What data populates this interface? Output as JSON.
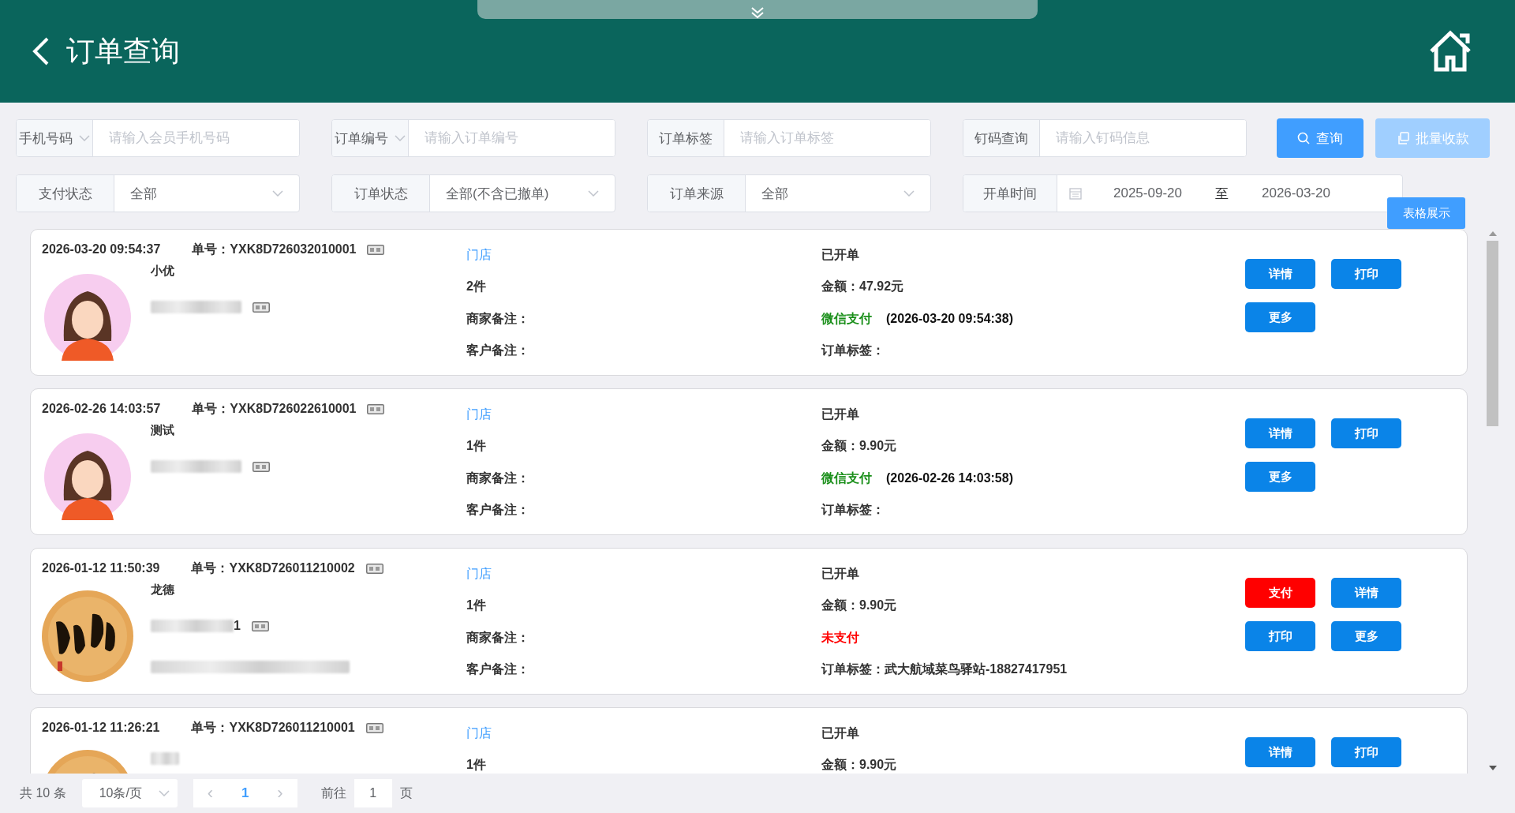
{
  "header": {
    "title": "订单查询"
  },
  "filters": [
    {
      "kind": "input",
      "label": "手机号码",
      "label_dropdown": true,
      "placeholder": "请输入会员手机号码"
    },
    {
      "kind": "input",
      "label": "订单编号",
      "label_dropdown": true,
      "placeholder": "请输入订单编号"
    },
    {
      "kind": "input",
      "label": "订单标签",
      "label_dropdown": false,
      "placeholder": "请输入订单标签"
    },
    {
      "kind": "input",
      "label": "钉码查询",
      "label_dropdown": false,
      "placeholder": "请输入钉码信息"
    },
    {
      "kind": "select",
      "label": "支付状态",
      "value": "全部"
    },
    {
      "kind": "select",
      "label": "订单状态",
      "value": "全部(不含已撤单)"
    },
    {
      "kind": "select",
      "label": "订单来源",
      "value": "全部"
    },
    {
      "kind": "daterange",
      "label": "开单时间",
      "start": "2025-09-20",
      "separator": "至",
      "end": "2026-03-20"
    }
  ],
  "buttons": [
    {
      "label": "查询",
      "kind": "primary"
    },
    {
      "label": "批量收款",
      "kind": "disabled"
    }
  ],
  "table_view_button": "表格展示",
  "orders": [
    {
      "created": "2026-03-20 09:54:37",
      "order_no": "单号：YXK8D726032010001",
      "avatar": {
        "kind": "figure"
      },
      "name": "小优",
      "redacted": [
        {
          "kind": "phone"
        }
      ],
      "source": "门店",
      "quantity": "2件",
      "merchant_note": "商家备注：",
      "customer_note": "客户备注：",
      "status": "已开单",
      "amount": "金额：47.92元",
      "payment": {
        "label": "微信支付",
        "paid": true,
        "time": "(2026-03-20 09:54:38)"
      },
      "tag": "订单标签：",
      "actions": [
        {
          "label": "详情",
          "kind": "primary"
        },
        {
          "label": "打印",
          "kind": "primary"
        },
        {
          "label": "更多",
          "kind": "primary"
        }
      ]
    },
    {
      "created": "2026-02-26 14:03:57",
      "order_no": "单号：YXK8D726022610001",
      "avatar": {
        "kind": "figure"
      },
      "name": "测试",
      "redacted": [
        {
          "kind": "phone"
        }
      ],
      "source": "门店",
      "quantity": "1件",
      "merchant_note": "商家备注：",
      "customer_note": "客户备注：",
      "status": "已开单",
      "amount": "金额：9.90元",
      "payment": {
        "label": "微信支付",
        "paid": true,
        "time": "(2026-02-26 14:03:58)"
      },
      "tag": "订单标签：",
      "actions": [
        {
          "label": "详情",
          "kind": "primary"
        },
        {
          "label": "打印",
          "kind": "primary"
        },
        {
          "label": "更多",
          "kind": "primary"
        }
      ]
    },
    {
      "created": "2026-01-12 11:50:39",
      "order_no": "单号：YXK8D726011210002",
      "avatar": {
        "kind": "picture"
      },
      "name": "龙德",
      "redacted": [
        {
          "kind": "phone",
          "tail": "1"
        },
        {
          "kind": "address"
        }
      ],
      "source": "门店",
      "quantity": "1件",
      "merchant_note": "商家备注：",
      "customer_note": "客户备注：",
      "status": "已开单",
      "amount": "金额：9.90元",
      "payment": {
        "label": "未支付",
        "paid": false
      },
      "tag": "订单标签：武大航域菜鸟驿站-18827417951",
      "actions": [
        {
          "label": "支付",
          "kind": "danger"
        },
        {
          "label": "详情",
          "kind": "primary"
        },
        {
          "label": "打印",
          "kind": "primary"
        },
        {
          "label": "更多",
          "kind": "primary"
        }
      ]
    },
    {
      "created": "2026-01-12 11:26:21",
      "order_no": "单号：YXK8D726011210001",
      "avatar": {
        "kind": "picture"
      },
      "name_redacted": true,
      "source": "门店",
      "quantity": "1件",
      "status": "已开单",
      "amount": "金额：9.90元",
      "actions": [
        {
          "label": "详情",
          "kind": "primary"
        },
        {
          "label": "打印",
          "kind": "primary"
        }
      ]
    }
  ],
  "pagination": {
    "total": "共 10 条",
    "page_size": "10条/页",
    "prev": "‹",
    "current": "1",
    "next": "›",
    "goto_label": "前往",
    "goto_value": "1",
    "page_unit": "页"
  }
}
